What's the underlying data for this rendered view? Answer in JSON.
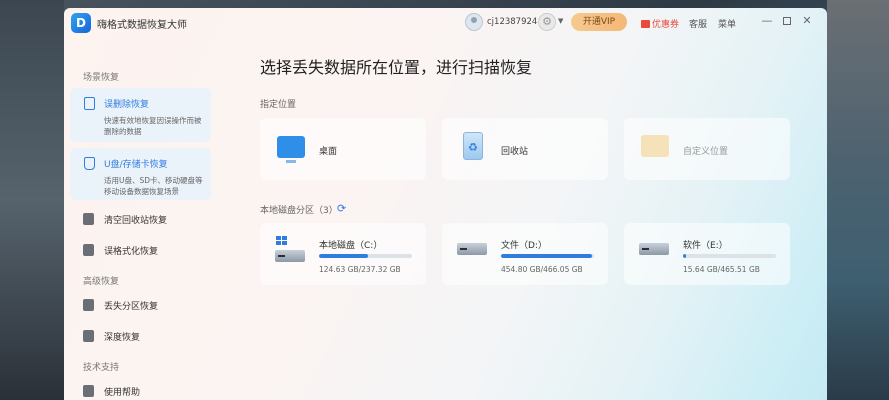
{
  "app": {
    "logo": "D",
    "title": "嗨格式数据恢复大师"
  },
  "header": {
    "user_name": "cj12387924",
    "vip_label": "开通VIP",
    "coupon_label": "优惠券",
    "service_label": "客服",
    "menu_label": "菜单"
  },
  "sidebar": {
    "section_scene": "场景恢复",
    "cards": [
      {
        "title": "误删除恢复",
        "desc": "快速有效地恢复因误操作而被删除的数据"
      },
      {
        "title": "U盘/存储卡恢复",
        "desc": "适用U盘、SD卡、移动硬盘等移动设备数据恢复场景"
      }
    ],
    "items_scene": [
      "清空回收站恢复",
      "误格式化恢复"
    ],
    "section_advanced": "高级恢复",
    "items_advanced": [
      "丢失分区恢复",
      "深度恢复"
    ],
    "section_support": "技术支持",
    "items_support": [
      "使用帮助"
    ]
  },
  "main": {
    "title": "选择丢失数据所在位置，进行扫描恢复",
    "locations_label": "指定位置",
    "locations": [
      "桌面",
      "回收站",
      "自定义位置"
    ],
    "partitions_label": "本地磁盘分区（3）",
    "disks": [
      {
        "name": "本地磁盘（C:）",
        "size": "124.63 GB/237.32 GB",
        "used_fraction": 0.525
      },
      {
        "name": "文件（D:）",
        "size": "454.80 GB/466.05 GB",
        "used_fraction": 0.976
      },
      {
        "name": "软件（E:）",
        "size": "15.64 GB/465.51 GB",
        "used_fraction": 0.034
      }
    ]
  },
  "colors": {
    "accent": "#2f7de1",
    "vip": "#f4b877",
    "coupon": "#e84b3c"
  },
  "icons": {
    "settings": "gear-icon",
    "refresh": "refresh-icon",
    "recycle": "recycle-bin-icon"
  }
}
